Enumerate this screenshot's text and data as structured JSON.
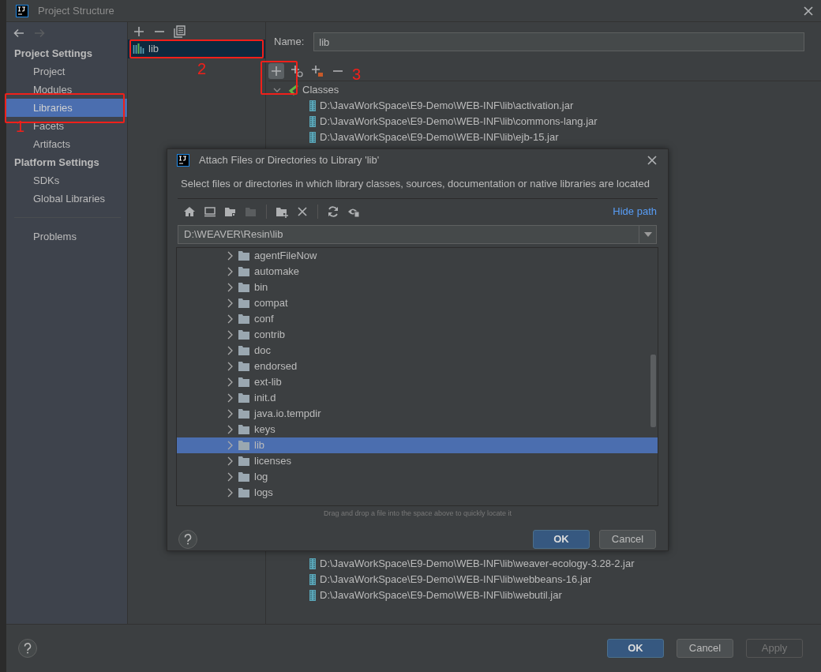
{
  "window": {
    "title": "Project Structure"
  },
  "navigation": [
    {
      "kind": "back",
      "disabled": false
    },
    {
      "kind": "forward",
      "disabled": true
    }
  ],
  "sidebar": {
    "groups": [
      {
        "title": "Project Settings",
        "items": [
          {
            "label": "Project",
            "selected": false
          },
          {
            "label": "Modules",
            "selected": false
          },
          {
            "label": "Libraries",
            "selected": true
          },
          {
            "label": "Facets",
            "selected": false
          },
          {
            "label": "Artifacts",
            "selected": false
          }
        ]
      },
      {
        "title": "Platform Settings",
        "items": [
          {
            "label": "SDKs",
            "selected": false
          },
          {
            "label": "Global Libraries",
            "selected": false
          }
        ]
      }
    ],
    "footer_items": [
      {
        "label": "Problems",
        "selected": false
      }
    ]
  },
  "library_toolbar": [
    {
      "kind": "add"
    },
    {
      "kind": "remove"
    },
    {
      "kind": "copy"
    }
  ],
  "libraries": [
    {
      "name": "lib",
      "selected": true
    }
  ],
  "name_field": {
    "label": "Name:",
    "value": "lib"
  },
  "classes_toolbar": [
    {
      "kind": "add",
      "selected": true
    },
    {
      "kind": "add-web",
      "selected": false
    },
    {
      "kind": "add-folder",
      "selected": false
    },
    {
      "kind": "remove",
      "selected": false
    }
  ],
  "classes": {
    "label": "Classes",
    "expanded": true,
    "children": [
      {
        "label": "D:\\JavaWorkSpace\\E9-Demo\\WEB-INF\\lib\\activation.jar"
      },
      {
        "label": "D:\\JavaWorkSpace\\E9-Demo\\WEB-INF\\lib\\commons-lang.jar"
      },
      {
        "label": "D:\\JavaWorkSpace\\E9-Demo\\WEB-INF\\lib\\ejb-15.jar"
      },
      {
        "label": "D:\\JavaWorkSpace\\E9-Demo\\WEB-INF\\lib\\weaver-ecology-3.28-2.jar"
      },
      {
        "label": "D:\\JavaWorkSpace\\E9-Demo\\WEB-INF\\lib\\webbeans-16.jar"
      },
      {
        "label": "D:\\JavaWorkSpace\\E9-Demo\\WEB-INF\\lib\\webutil.jar"
      }
    ]
  },
  "buttons": [
    {
      "label": "OK",
      "primary": true,
      "disabled": false
    },
    {
      "label": "Cancel",
      "primary": false,
      "disabled": false
    },
    {
      "label": "Apply",
      "primary": false,
      "disabled": true
    }
  ],
  "dialog": {
    "title": "Attach Files or Directories to Library 'lib'",
    "description": "Select files or directories in which library classes, sources, documentation or native libraries are located",
    "toolbar_groups": [
      {
        "items": [
          {
            "kind": "home",
            "disabled": false
          },
          {
            "kind": "desktop",
            "disabled": false
          },
          {
            "kind": "project-folder",
            "disabled": false
          },
          {
            "kind": "module-folder",
            "disabled": true
          }
        ]
      },
      {
        "items": [
          {
            "kind": "new-folder",
            "disabled": false
          },
          {
            "kind": "delete",
            "disabled": false
          }
        ]
      },
      {
        "items": [
          {
            "kind": "refresh",
            "disabled": false
          },
          {
            "kind": "show-hidden",
            "disabled": false
          }
        ]
      }
    ],
    "hide_path_link": "Hide path",
    "path": "D:\\WEAVER\\Resin\\lib",
    "tree": [
      {
        "label": "agentFileNow",
        "selected": false,
        "expanded": false
      },
      {
        "label": "automake",
        "selected": false,
        "expanded": false
      },
      {
        "label": "bin",
        "selected": false,
        "expanded": false
      },
      {
        "label": "compat",
        "selected": false,
        "expanded": false
      },
      {
        "label": "conf",
        "selected": false,
        "expanded": false
      },
      {
        "label": "contrib",
        "selected": false,
        "expanded": false
      },
      {
        "label": "doc",
        "selected": false,
        "expanded": false
      },
      {
        "label": "endorsed",
        "selected": false,
        "expanded": false
      },
      {
        "label": "ext-lib",
        "selected": false,
        "expanded": false
      },
      {
        "label": "init.d",
        "selected": false,
        "expanded": false
      },
      {
        "label": "java.io.tempdir",
        "selected": false,
        "expanded": false
      },
      {
        "label": "keys",
        "selected": false,
        "expanded": false
      },
      {
        "label": "lib",
        "selected": true,
        "expanded": false
      },
      {
        "label": "licenses",
        "selected": false,
        "expanded": false
      },
      {
        "label": "log",
        "selected": false,
        "expanded": false
      },
      {
        "label": "logs",
        "selected": false,
        "expanded": false
      }
    ],
    "hint": "Drag and drop a file into the space above to quickly locate it",
    "buttons": [
      {
        "label": "OK",
        "primary": true
      },
      {
        "label": "Cancel",
        "primary": false
      }
    ]
  },
  "annotations": [
    {
      "label": "1"
    },
    {
      "label": "2"
    },
    {
      "label": "3"
    }
  ]
}
